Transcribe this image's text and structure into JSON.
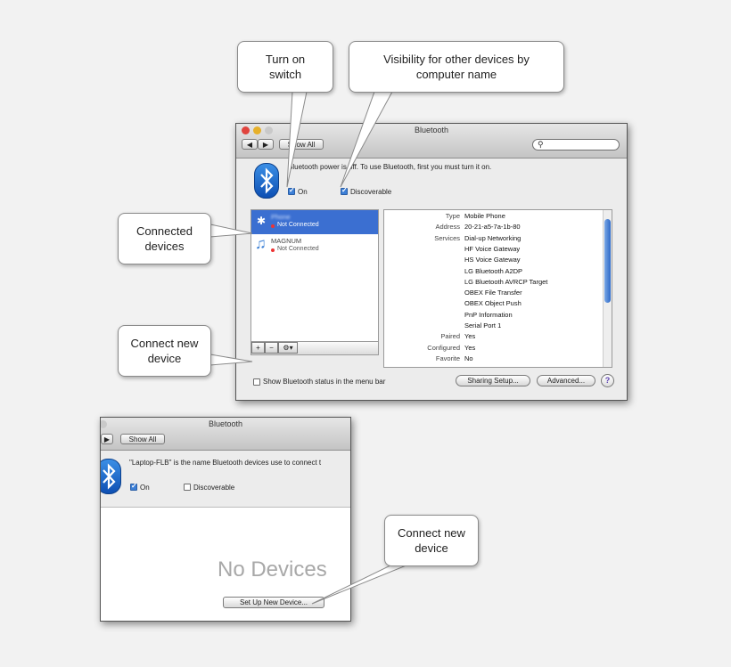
{
  "callouts": {
    "turn_on": "Turn on switch",
    "visibility": "Visibility for other devices by computer name",
    "connected": "Connected devices",
    "connect_new": "Connect new device",
    "connect_new_2": "Connect new device"
  },
  "window1": {
    "title": "Bluetooth",
    "show_all": "Show All",
    "power_text": "Bluetooth power is off. To use Bluetooth, first you must turn it on.",
    "on_label": "On",
    "discoverable_label": "Discoverable",
    "devices": [
      {
        "name": "Phone",
        "status": "Not Connected"
      },
      {
        "name": "MAGNUM",
        "status": "Not Connected"
      }
    ],
    "details": [
      {
        "label": "Type",
        "value": "Mobile Phone"
      },
      {
        "label": "Address",
        "value": "20-21-a5-7a-1b-80"
      },
      {
        "label": "Services",
        "value": "Dial-up Networking"
      },
      {
        "label": "",
        "value": "HF Voice Gateway"
      },
      {
        "label": "",
        "value": "HS Voice Gateway"
      },
      {
        "label": "",
        "value": "LG Bluetooth A2DP"
      },
      {
        "label": "",
        "value": "LG Bluetooth AVRCP Target"
      },
      {
        "label": "",
        "value": "OBEX File Transfer"
      },
      {
        "label": "",
        "value": "OBEX Object Push"
      },
      {
        "label": "",
        "value": "PnP Information"
      },
      {
        "label": "",
        "value": "Serial Port 1"
      },
      {
        "label": "Paired",
        "value": "Yes"
      },
      {
        "label": "Configured",
        "value": "Yes"
      },
      {
        "label": "Favorite",
        "value": "No"
      }
    ],
    "show_status": "Show Bluetooth status in the menu bar",
    "sharing_setup": "Sharing Setup...",
    "advanced": "Advanced...",
    "help": "?",
    "add": "+",
    "remove": "−",
    "gear": "⚙▾"
  },
  "window2": {
    "title": "Bluetooth",
    "show_all": "Show All",
    "name_text": "\"Laptop-FLB\" is the name Bluetooth devices use to connect t",
    "on_label": "On",
    "discoverable_label": "Discoverable",
    "no_devices": "No Devices",
    "setup_button": "Set Up New Device..."
  },
  "colors": {
    "accent": "#3d7fd8",
    "selected_row": "#3b6fd1"
  },
  "icons": [
    "bluetooth-icon",
    "music-note-icon",
    "search-icon",
    "gear-icon",
    "help-icon"
  ]
}
